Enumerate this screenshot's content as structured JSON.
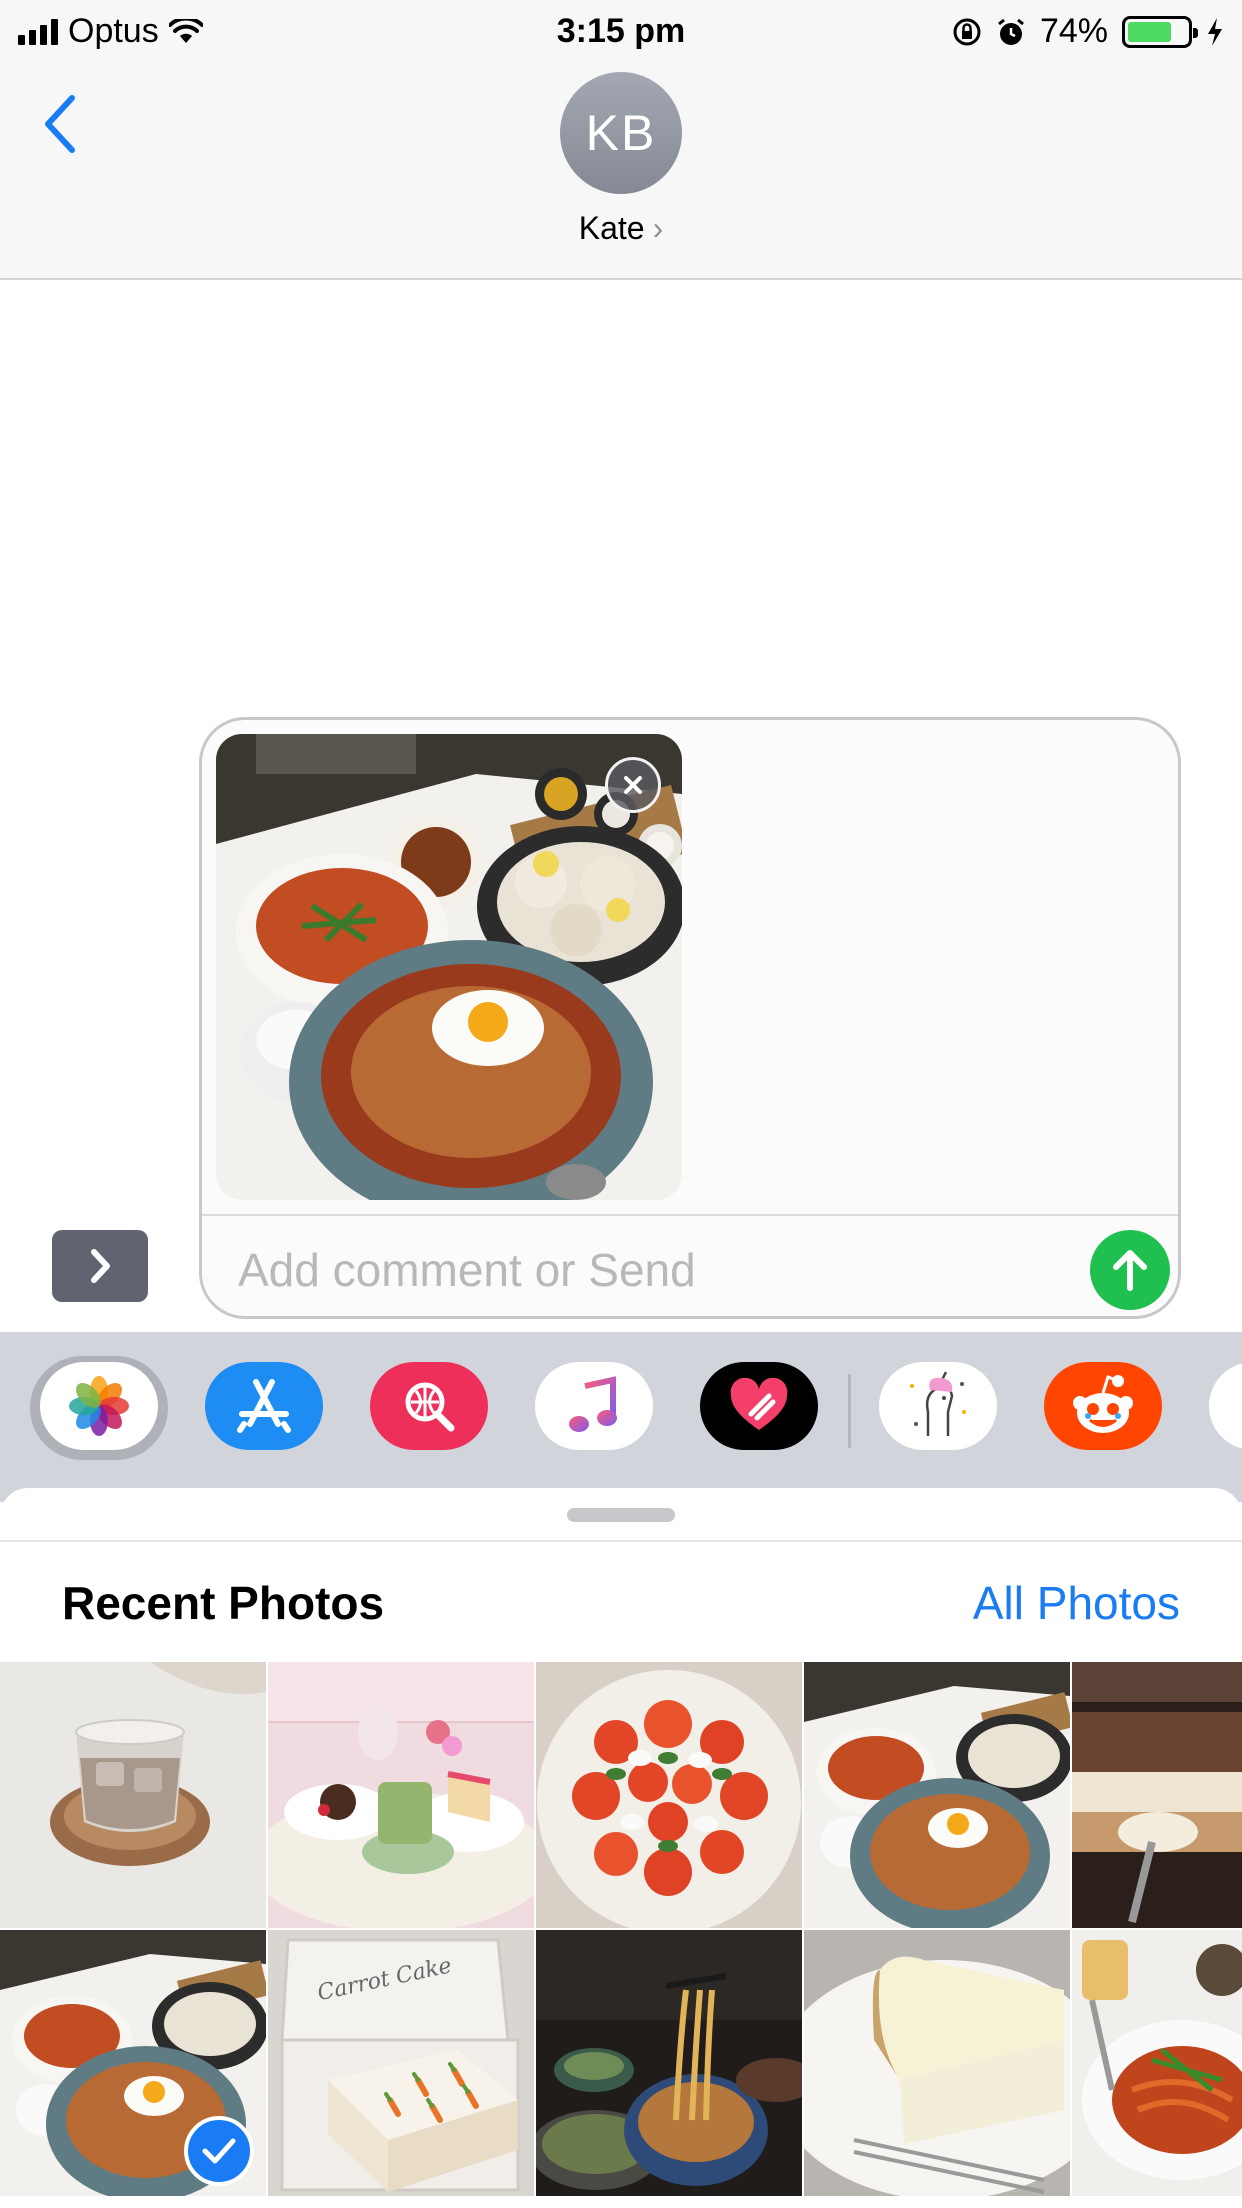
{
  "status_bar": {
    "carrier": "Optus",
    "time": "3:15 pm",
    "battery_percent": "74%",
    "battery_level": 0.74,
    "icons": [
      "signal-icon",
      "wifi-icon",
      "orientation-lock-icon",
      "alarm-icon",
      "battery-icon",
      "charging-icon"
    ]
  },
  "header": {
    "avatar_initials": "KB",
    "contact_name": "Kate",
    "back_icon": "chevron-left-icon"
  },
  "compose": {
    "placeholder": "Add comment or Send",
    "value": "",
    "attachment": "food-photo",
    "remove_icon": "close-icon",
    "send_icon": "arrow-up-icon",
    "expand_icon": "chevron-right-icon",
    "accent_color": "#20c050"
  },
  "app_drawer": {
    "apps": [
      "photos-app",
      "app-store-app",
      "search-images-app",
      "music-app",
      "digital-touch-app",
      "unicorn-stickers-app",
      "reddit-app",
      "partial-app"
    ],
    "selected": "photos-app"
  },
  "photos": {
    "title": "Recent Photos",
    "all_link": "All Photos",
    "link_color": "#1a7cf5",
    "items": [
      {
        "subject": "iced-latte"
      },
      {
        "subject": "cafe-desserts"
      },
      {
        "subject": "caprese-salad"
      },
      {
        "subject": "meal-set"
      },
      {
        "subject": "tiramisu"
      },
      {
        "subject": "meal-set",
        "selected": true
      },
      {
        "subject": "carrot-cake",
        "text": "Carrot Cake"
      },
      {
        "subject": "noodles"
      },
      {
        "subject": "cheesecake"
      },
      {
        "subject": "pasta"
      }
    ]
  }
}
